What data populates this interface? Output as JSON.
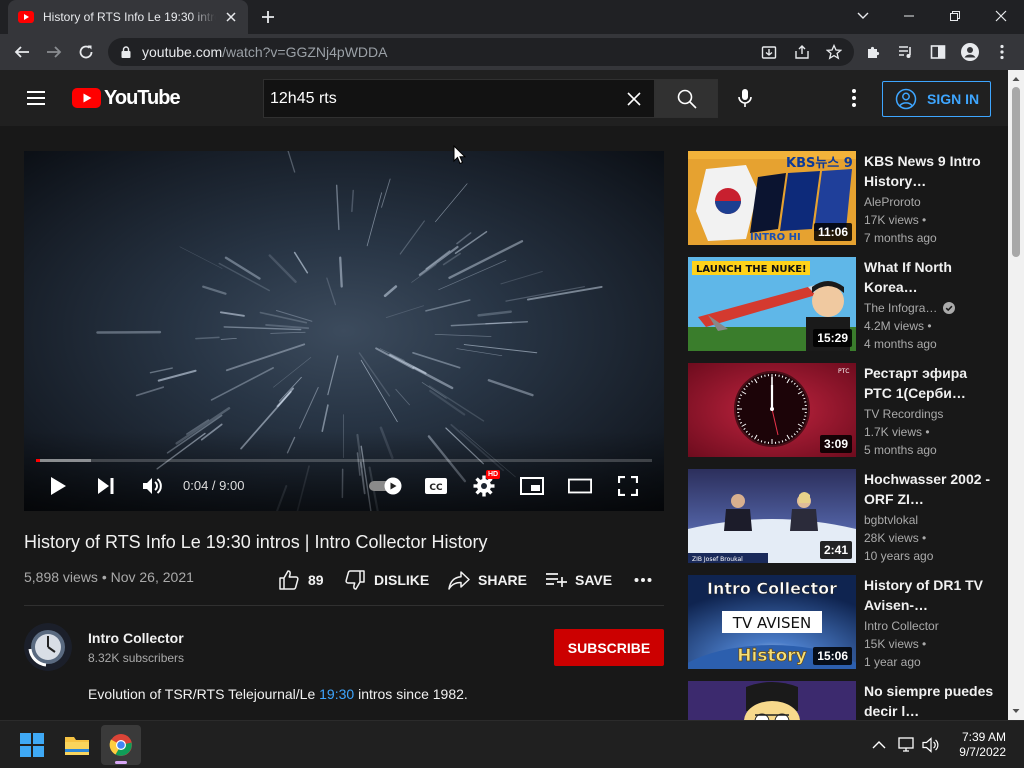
{
  "browser": {
    "tab_title": "History of RTS Info Le 19:30 intros | Intro Collector History",
    "url_host": "youtube.com",
    "url_path": "/watch?v=GGZNj4pWDDA"
  },
  "masthead": {
    "logo_text": "YouTube",
    "search_value": "12h45 rts",
    "signin_label": "SIGN IN"
  },
  "player": {
    "current_time": "0:04",
    "duration": "9:00",
    "time_text": "0:04 / 9:00",
    "progress_fraction": 0.007,
    "buffered_fraction": 0.09,
    "hd_badge": "HD"
  },
  "video": {
    "title": "History of RTS Info Le 19:30 intros | Intro Collector History",
    "stats": "5,898 views • Nov 26, 2021",
    "likes": "89",
    "dislike_label": "DISLIKE",
    "share_label": "SHARE",
    "save_label": "SAVE"
  },
  "channel": {
    "name": "Intro Collector",
    "subscribers": "8.32K subscribers",
    "subscribe_label": "SUBSCRIBE"
  },
  "description": {
    "before": "Evolution of TSR/RTS Telejournal/Le ",
    "link": "19:30",
    "after": " intros since 1982."
  },
  "recommendations": [
    {
      "title": "KBS News 9 Intro History…",
      "channel": "AleProroto",
      "views": "17K views •",
      "age": "7 months ago",
      "duration": "11:06",
      "thumb_text": [
        "KBS뉴스 9",
        "INTRO HI"
      ]
    },
    {
      "title": "What If North Korea…",
      "channel": "The Infogra…",
      "verified": true,
      "views": "4.2M views •",
      "age": "4 months ago",
      "duration": "15:29",
      "thumb_text": [
        "LAUNCH THE NUKE!"
      ]
    },
    {
      "title": "Рестарт эфира РТС 1(Серби…",
      "channel": "TV Recordings",
      "views": "1.7K views •",
      "age": "5 months ago",
      "duration": "3:09",
      "thumb_text": [
        "РТС"
      ]
    },
    {
      "title": "Hochwasser 2002 - ORF ZI…",
      "channel": "bgbtvlokal",
      "views": "28K views •",
      "age": "10 years ago",
      "duration": "2:41",
      "thumb_text": [
        "ZIB Josef Broukal"
      ]
    },
    {
      "title": "History of DR1 TV Avisen-…",
      "channel": "Intro Collector",
      "views": "15K views •",
      "age": "1 year ago",
      "duration": "15:06",
      "thumb_text": [
        "Intro Collector",
        "TV AVISEN",
        "History"
      ]
    },
    {
      "title": "No siempre puedes decir l…",
      "channel": "",
      "views": "",
      "age": "",
      "duration": ""
    }
  ],
  "taskbar": {
    "time": "7:39 AM",
    "date": "9/7/2022"
  },
  "colors": {
    "brand_red": "#ff0000",
    "subscribe_red": "#cc0000",
    "link_blue": "#3ea6ff",
    "page_bg": "#181818"
  }
}
